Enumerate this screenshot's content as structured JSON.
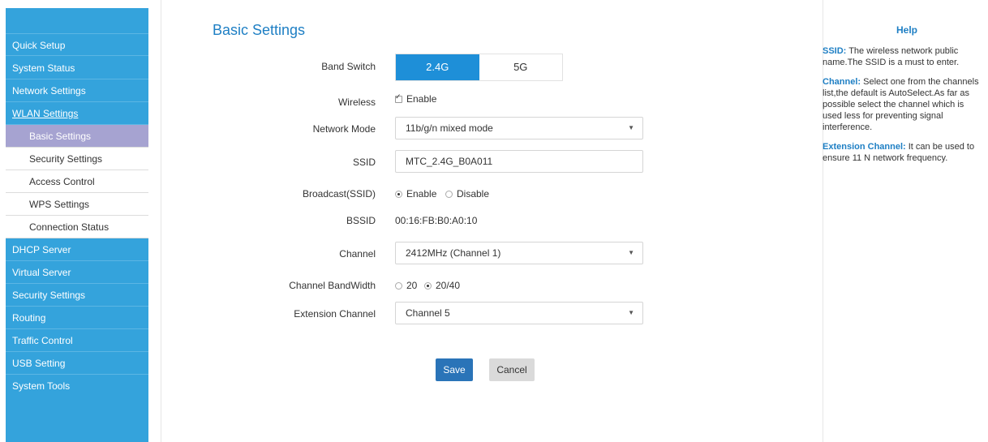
{
  "sidebar": {
    "items": [
      {
        "label": "Quick Setup"
      },
      {
        "label": "System Status"
      },
      {
        "label": "Network Settings"
      },
      {
        "label": "WLAN Settings"
      }
    ],
    "sub_items": [
      {
        "label": "Basic Settings"
      },
      {
        "label": "Security Settings"
      },
      {
        "label": "Access Control"
      },
      {
        "label": "WPS Settings"
      },
      {
        "label": "Connection Status"
      }
    ],
    "items_after": [
      {
        "label": "DHCP Server"
      },
      {
        "label": "Virtual Server"
      },
      {
        "label": "Security Settings"
      },
      {
        "label": "Routing"
      },
      {
        "label": "Traffic Control"
      },
      {
        "label": "USB Setting"
      },
      {
        "label": "System Tools"
      }
    ]
  },
  "main": {
    "title": "Basic Settings",
    "band_switch": {
      "label": "Band Switch",
      "options": [
        "2.4G",
        "5G"
      ],
      "selected": "2.4G"
    },
    "wireless": {
      "label": "Wireless",
      "checkbox_label": "Enable",
      "checked": true
    },
    "network_mode": {
      "label": "Network Mode",
      "value": "11b/g/n mixed mode"
    },
    "ssid": {
      "label": "SSID",
      "value": "MTC_2.4G_B0A011"
    },
    "broadcast": {
      "label": "Broadcast(SSID)",
      "options": [
        "Enable",
        "Disable"
      ],
      "selected": "Enable"
    },
    "bssid": {
      "label": "BSSID",
      "value": "00:16:FB:B0:A0:10"
    },
    "channel": {
      "label": "Channel",
      "value": "2412MHz (Channel 1)"
    },
    "bandwidth": {
      "label": "Channel BandWidth",
      "options": [
        "20",
        "20/40"
      ],
      "selected": "20/40"
    },
    "extension_channel": {
      "label": "Extension Channel",
      "value": "Channel 5"
    },
    "save_label": "Save",
    "cancel_label": "Cancel"
  },
  "help": {
    "title": "Help",
    "entries": [
      {
        "term": "SSID:",
        "text": " The wireless network public name.The SSID is a must to enter."
      },
      {
        "term": "Channel:",
        "text": " Select one from the channels list,the default is AutoSelect.As far as possible select the channel which is used less for preventing signal interference."
      },
      {
        "term": "Extension Channel:",
        "text": " It can be used to ensure 11 N network frequency."
      }
    ]
  },
  "colors": {
    "sidebar_bg": "#34a3dc",
    "active_sub_bg": "#a6a3d1",
    "accent": "#1e7fc4",
    "band_active": "#1e8fd8",
    "save_button": "#2a74b8"
  }
}
